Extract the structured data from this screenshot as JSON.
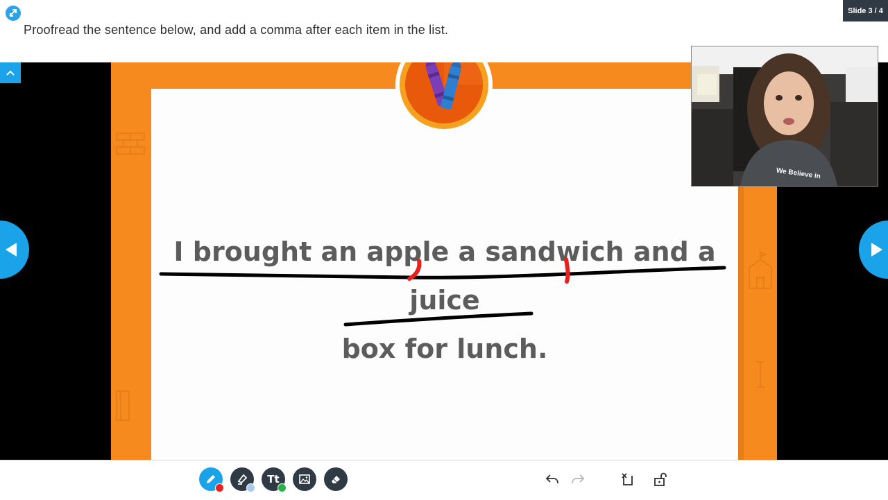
{
  "header": {
    "instruction": "Proofread the sentence below, and add a comma after each item in the list.",
    "slide_counter": "Slide 3 / 4"
  },
  "slide": {
    "line1": "I brought an apple a sandwich and a juice",
    "line2": "box for lunch.",
    "accent_color": "#f68a1e",
    "badge_colors": [
      "#e8590c",
      "#f6a020",
      "#7b3fb5",
      "#2f7fd1"
    ]
  },
  "webcam": {
    "shirt_text": "We Believe in"
  },
  "toolbar": {
    "tools": [
      {
        "name": "pen-tool",
        "icon": "pencil-icon",
        "color": "#1aa3e8",
        "indicator": "#e8201e"
      },
      {
        "name": "highlighter-tool",
        "icon": "highlighter-icon",
        "color": "#2f3a44",
        "indicator": "#a9c9f0"
      },
      {
        "name": "text-tool",
        "icon": "text-icon",
        "label": "Tt",
        "color": "#2f3a44",
        "indicator": "#28b04a"
      },
      {
        "name": "image-tool",
        "icon": "image-icon",
        "color": "#2f3a44"
      },
      {
        "name": "eraser-tool",
        "icon": "eraser-icon",
        "color": "#2f3a44"
      }
    ],
    "actions": [
      "undo-icon",
      "redo-icon",
      "clear-icon",
      "lock-icon"
    ]
  },
  "navigation": {
    "prev_icon": "chevron-left-icon",
    "next_icon": "chevron-right-icon",
    "collapse_icon": "chevron-up-icon"
  }
}
